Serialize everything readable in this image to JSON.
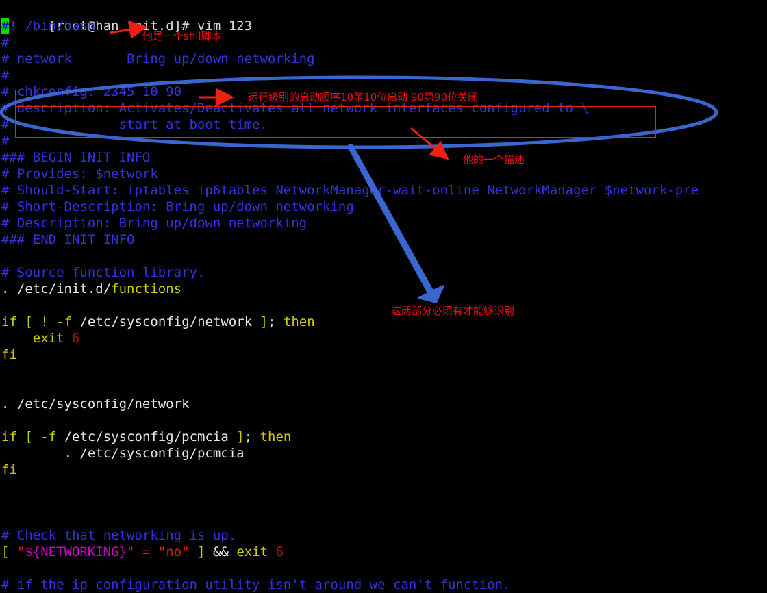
{
  "window": {
    "title": "vim 123",
    "background": "#000000"
  },
  "colors": {
    "comment_blue": "#3333dd",
    "keyword_yellow": "#cdcd00",
    "plain_white": "#e5e5e5",
    "number_red": "#cc0000",
    "string_red": "#cc2200",
    "variable_magenta": "#cd00cd",
    "cursor_green": "#00dd00",
    "annotation_red": "#ee1111",
    "annotation_blue": "#3a66d0"
  },
  "prompt": {
    "text": "[root@han init.d]# vim 123",
    "user": "root",
    "host": "han",
    "cwd": "init.d",
    "command": "vim 123"
  },
  "code_lines": [
    {
      "id": "line-shebang",
      "tokens": [
        {
          "t": "#",
          "c": "cursor"
        },
        {
          "t": "! /bin/bash",
          "c": "c-comment"
        }
      ]
    },
    {
      "id": "line-hash-1",
      "tokens": [
        {
          "t": "#",
          "c": "c-comment"
        }
      ]
    },
    {
      "id": "line-network-desc",
      "tokens": [
        {
          "t": "# network       Bring up/down networking",
          "c": "c-comment"
        }
      ]
    },
    {
      "id": "line-hash-2",
      "tokens": [
        {
          "t": "#",
          "c": "c-comment"
        }
      ]
    },
    {
      "id": "line-chkconfig",
      "tokens": [
        {
          "t": "# chkconfig: 2345 10 90",
          "c": "c-comment"
        }
      ]
    },
    {
      "id": "line-description-1",
      "tokens": [
        {
          "t": "# description: Activates/Deactivates all network interfaces configured to \\",
          "c": "c-comment"
        }
      ]
    },
    {
      "id": "line-description-2",
      "tokens": [
        {
          "t": "#              start at boot time.",
          "c": "c-comment"
        }
      ]
    },
    {
      "id": "line-hash-3",
      "tokens": [
        {
          "t": "#",
          "c": "c-comment"
        }
      ]
    },
    {
      "id": "line-begin-init-info",
      "tokens": [
        {
          "t": "### BEGIN INIT INFO",
          "c": "c-comment"
        }
      ]
    },
    {
      "id": "line-provides",
      "tokens": [
        {
          "t": "# Provides: $network",
          "c": "c-comment"
        }
      ]
    },
    {
      "id": "line-should-start",
      "tokens": [
        {
          "t": "# Should-Start: iptables ip6tables NetworkManager-wait-online NetworkManager $network-pre",
          "c": "c-comment"
        }
      ]
    },
    {
      "id": "line-short-description",
      "tokens": [
        {
          "t": "# Short-Description: Bring up/down networking",
          "c": "c-comment"
        }
      ]
    },
    {
      "id": "line-description-info",
      "tokens": [
        {
          "t": "# Description: Bring up/down networking",
          "c": "c-comment"
        }
      ]
    },
    {
      "id": "line-end-init-info",
      "tokens": [
        {
          "t": "### END INIT INFO",
          "c": "c-comment"
        }
      ]
    },
    {
      "id": "line-blank-1",
      "tokens": [
        {
          "t": " ",
          "c": "c-plain"
        }
      ]
    },
    {
      "id": "line-source-comment",
      "tokens": [
        {
          "t": "# Source function library.",
          "c": "c-comment"
        }
      ]
    },
    {
      "id": "line-source-functions",
      "tokens": [
        {
          "t": ". ",
          "c": "c-plain"
        },
        {
          "t": "/etc/init.d/",
          "c": "c-plain"
        },
        {
          "t": "functions",
          "c": "c-keyword"
        }
      ]
    },
    {
      "id": "line-blank-2",
      "tokens": [
        {
          "t": " ",
          "c": "c-plain"
        }
      ]
    },
    {
      "id": "line-if-network",
      "tokens": [
        {
          "t": "if",
          "c": "c-keyword"
        },
        {
          "t": " ",
          "c": "c-plain"
        },
        {
          "t": "[",
          "c": "c-keyword"
        },
        {
          "t": " ",
          "c": "c-plain"
        },
        {
          "t": "!",
          "c": "c-keyword"
        },
        {
          "t": " ",
          "c": "c-plain"
        },
        {
          "t": "-f",
          "c": "c-keyword"
        },
        {
          "t": " /etc/sysconfig/network ",
          "c": "c-plain"
        },
        {
          "t": "]",
          "c": "c-keyword"
        },
        {
          "t": "; ",
          "c": "c-plain"
        },
        {
          "t": "then",
          "c": "c-keyword"
        }
      ]
    },
    {
      "id": "line-exit-6-a",
      "tokens": [
        {
          "t": "    ",
          "c": "c-plain"
        },
        {
          "t": "exit",
          "c": "c-keyword"
        },
        {
          "t": " ",
          "c": "c-plain"
        },
        {
          "t": "6",
          "c": "c-number"
        }
      ]
    },
    {
      "id": "line-fi-1",
      "tokens": [
        {
          "t": "fi",
          "c": "c-keyword"
        }
      ]
    },
    {
      "id": "line-blank-3",
      "tokens": [
        {
          "t": " ",
          "c": "c-plain"
        }
      ]
    },
    {
      "id": "line-blank-4",
      "tokens": [
        {
          "t": " ",
          "c": "c-plain"
        }
      ]
    },
    {
      "id": "line-source-network",
      "tokens": [
        {
          "t": ". ",
          "c": "c-plain"
        },
        {
          "t": "/etc/sysconfig/network",
          "c": "c-plain"
        }
      ]
    },
    {
      "id": "line-blank-5",
      "tokens": [
        {
          "t": " ",
          "c": "c-plain"
        }
      ]
    },
    {
      "id": "line-if-pcmcia",
      "tokens": [
        {
          "t": "if",
          "c": "c-keyword"
        },
        {
          "t": " ",
          "c": "c-plain"
        },
        {
          "t": "[",
          "c": "c-keyword"
        },
        {
          "t": " ",
          "c": "c-plain"
        },
        {
          "t": "-f",
          "c": "c-keyword"
        },
        {
          "t": " /etc/sysconfig/pcmcia ",
          "c": "c-plain"
        },
        {
          "t": "]",
          "c": "c-keyword"
        },
        {
          "t": "; ",
          "c": "c-plain"
        },
        {
          "t": "then",
          "c": "c-keyword"
        }
      ]
    },
    {
      "id": "line-source-pcmcia",
      "tokens": [
        {
          "t": "        . ",
          "c": "c-plain"
        },
        {
          "t": "/etc/sysconfig/pcmcia",
          "c": "c-plain"
        }
      ]
    },
    {
      "id": "line-fi-2",
      "tokens": [
        {
          "t": "fi",
          "c": "c-keyword"
        }
      ]
    },
    {
      "id": "line-blank-6",
      "tokens": [
        {
          "t": " ",
          "c": "c-plain"
        }
      ]
    },
    {
      "id": "line-blank-7",
      "tokens": [
        {
          "t": " ",
          "c": "c-plain"
        }
      ]
    },
    {
      "id": "line-blank-8",
      "tokens": [
        {
          "t": " ",
          "c": "c-plain"
        }
      ]
    },
    {
      "id": "line-check-networking-comment",
      "tokens": [
        {
          "t": "# Check that networking is up.",
          "c": "c-comment"
        }
      ]
    },
    {
      "id": "line-networking-test",
      "tokens": [
        {
          "t": "[",
          "c": "c-keyword"
        },
        {
          "t": " ",
          "c": "c-plain"
        },
        {
          "t": "\"",
          "c": "c-string"
        },
        {
          "t": "${NETWORKING}",
          "c": "c-var"
        },
        {
          "t": "\"",
          "c": "c-string"
        },
        {
          "t": " ",
          "c": "c-plain"
        },
        {
          "t": "=",
          "c": "c-string"
        },
        {
          "t": " ",
          "c": "c-plain"
        },
        {
          "t": "\"no\"",
          "c": "c-string"
        },
        {
          "t": " ",
          "c": "c-plain"
        },
        {
          "t": "]",
          "c": "c-keyword"
        },
        {
          "t": " ",
          "c": "c-plain"
        },
        {
          "t": "&&",
          "c": "c-plain"
        },
        {
          "t": " ",
          "c": "c-plain"
        },
        {
          "t": "exit",
          "c": "c-keyword"
        },
        {
          "t": " ",
          "c": "c-plain"
        },
        {
          "t": "6",
          "c": "c-number"
        }
      ]
    },
    {
      "id": "line-blank-9",
      "tokens": [
        {
          "t": " ",
          "c": "c-plain"
        }
      ]
    },
    {
      "id": "line-ip-config-comment",
      "tokens": [
        {
          "t": "# if the ip configuration utility isn't around we can't function.",
          "c": "c-comment"
        }
      ]
    }
  ],
  "annotations": {
    "shebang_note": "他是一个shll脚本",
    "chkconfig_note": "运行级别的启动顺序10第10位启动 90第90位关闭",
    "description_note": "他的一个描述",
    "required_parts_note": "这两部分必须有才能够识别"
  }
}
